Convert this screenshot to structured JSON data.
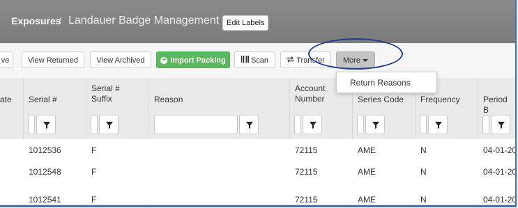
{
  "breadcrumb": {
    "root": "Exposures",
    "separator": "/",
    "current": "Landauer Badge Management"
  },
  "header_button": "Edit Labels",
  "toolbar": {
    "partial_button": "ve",
    "view_returned": "View Returned",
    "view_archived": "View Archived",
    "import_packing": "Import Packing",
    "scan": "Scan",
    "transfer": "Transfer",
    "more": "More"
  },
  "more_menu": [
    "Return Reasons"
  ],
  "columns": [
    {
      "label": "ate"
    },
    {
      "label": "Serial #"
    },
    {
      "label": "Serial # Suffix"
    },
    {
      "label": "Reason"
    },
    {
      "label": "Account Number"
    },
    {
      "label": "Series Code"
    },
    {
      "label": "Frequency"
    },
    {
      "label": "Period B"
    }
  ],
  "rows": [
    {
      "serial": "1012536",
      "suffix": "F",
      "reason": "",
      "account": "72115",
      "series": "AME",
      "frequency": "N",
      "period": "04-01-20"
    },
    {
      "serial": "1012548",
      "suffix": "F",
      "reason": "",
      "account": "72115",
      "series": "AME",
      "frequency": "N",
      "period": "04-01-20"
    },
    {
      "serial": "1012541",
      "suffix": "F",
      "reason": "",
      "account": "72115",
      "series": "AME",
      "frequency": "N",
      "period": "04-01-20"
    }
  ],
  "colors": {
    "header_bg": "#7b7b7b",
    "accent_green": "#5cb85c",
    "annotation_ellipse": "#233e8b",
    "window_border": "#3a6fc4"
  }
}
